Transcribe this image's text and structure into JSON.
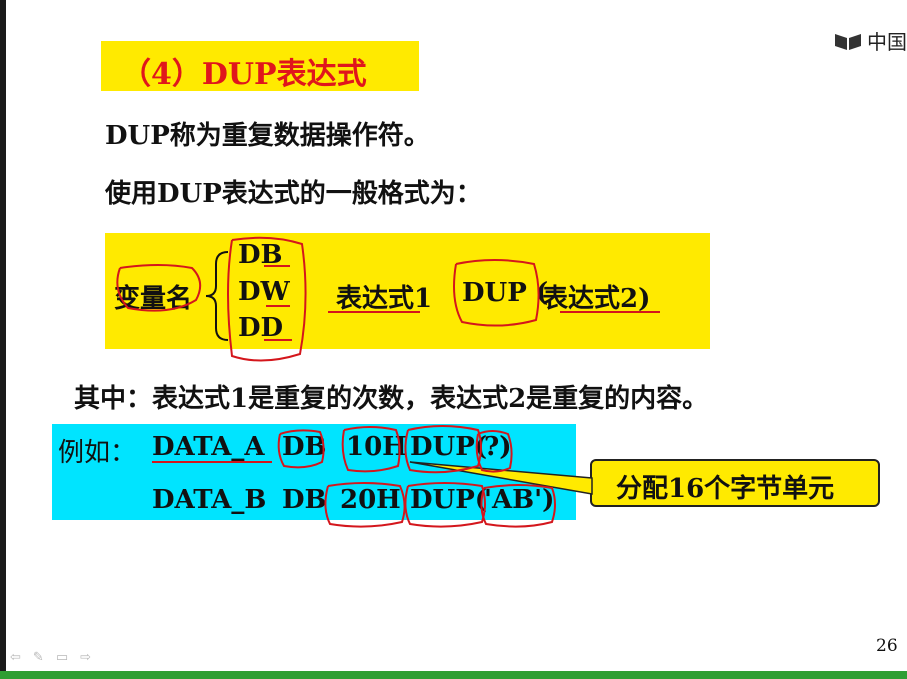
{
  "logo": {
    "text": "中国",
    "icon": "book-logo-icon"
  },
  "title": "（4）DUP表达式",
  "line1": "DUP称为重复数据操作符。",
  "line2": "使用DUP表达式的一般格式为：",
  "format": {
    "var_name": "变量名",
    "directives": [
      "DB",
      "DW",
      "DD"
    ],
    "expr1": "表达式1",
    "dup": "DUP (",
    "expr2": "表达式2)"
  },
  "explain": "其中：表达式1是重复的次数，表达式2是重复的内容。",
  "example": {
    "label": "例如：",
    "row1": {
      "name": "DATA_A",
      "dir": "DB",
      "count": "10H",
      "dup": "DUP(",
      "content": "?)"
    },
    "row2": {
      "name": "DATA_B",
      "dir": "DB",
      "count": "20H",
      "dup": "DUP(",
      "content": "'AB')"
    }
  },
  "callout": "分配16个字节单元",
  "page_number": "26",
  "colors": {
    "title": "#e0161c",
    "highlight": "#ffea00",
    "example_bg": "#00e4ff",
    "pen": "#d4161c"
  }
}
